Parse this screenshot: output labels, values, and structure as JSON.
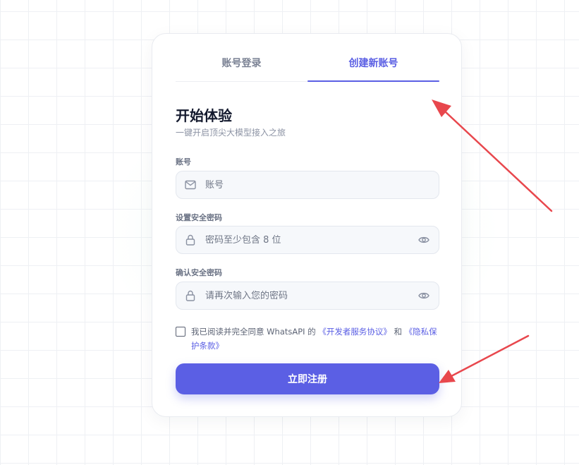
{
  "tabs": [
    {
      "label": "账号登录",
      "active": false
    },
    {
      "label": "创建新账号",
      "active": true
    }
  ],
  "form": {
    "title": "开始体验",
    "subtitle": "一键开启顶尖大模型接入之旅",
    "account": {
      "label": "账号",
      "placeholder": "账号",
      "value": ""
    },
    "password": {
      "label": "设置安全密码",
      "placeholder": "密码至少包含 8 位",
      "value": ""
    },
    "confirm": {
      "label": "确认安全密码",
      "placeholder": "请再次输入您的密码",
      "value": ""
    },
    "agreement": {
      "checked": false,
      "prefix": "我已阅读并完全同意 WhatsAPI 的",
      "link1": "《开发者服务协议》",
      "middle": "和",
      "link2": "《隐私保护条款》"
    },
    "submit_label": "立即注册"
  },
  "icons": {
    "account": "mail-icon",
    "password": "lock-icon",
    "confirm": "lock-icon",
    "toggle": "eye-icon"
  },
  "colors": {
    "accent": "#5b5fe4",
    "annotation": "#e8474d"
  }
}
